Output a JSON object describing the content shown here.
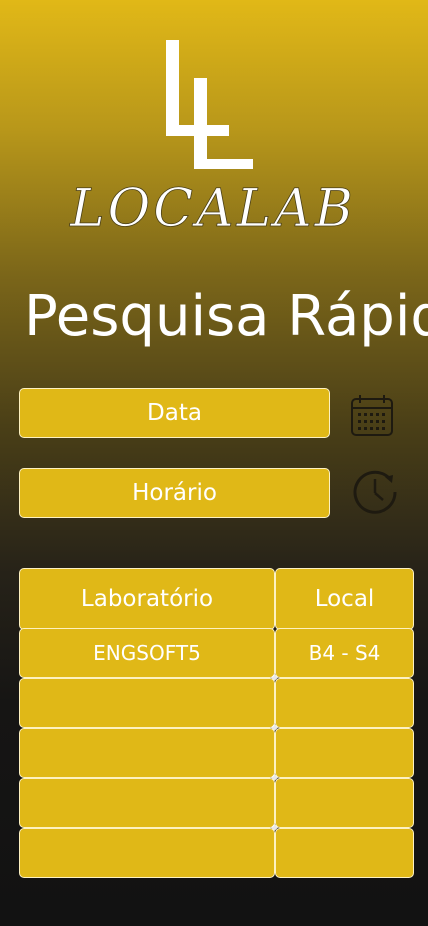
{
  "app": {
    "brand": "LOCALAB"
  },
  "page": {
    "title": "Pesquisa Rápida"
  },
  "search": {
    "date_label": "Data",
    "time_label": "Horário"
  },
  "table": {
    "headers": [
      "Laboratório",
      "Local"
    ],
    "rows": [
      [
        "ENGSOFT5",
        "B4 - S4"
      ],
      [
        "",
        ""
      ],
      [
        "",
        ""
      ],
      [
        "",
        ""
      ],
      [
        "",
        ""
      ]
    ]
  },
  "icons": {
    "date": "calendar-icon",
    "time": "clock-icon"
  },
  "colors": {
    "accent": "#e0b817",
    "border": "#fdf1c1",
    "text": "#ffffff",
    "background_dark": "#121212"
  }
}
